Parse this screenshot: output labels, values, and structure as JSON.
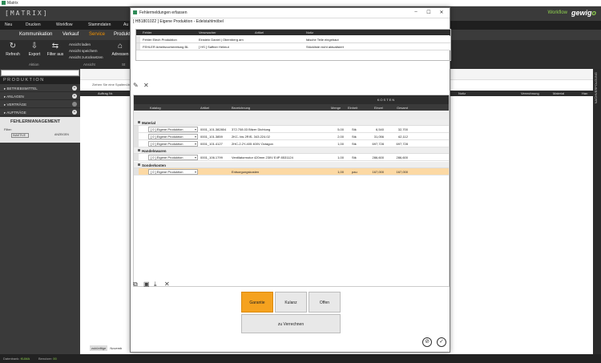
{
  "app": {
    "title": "Matrix",
    "brand": "[MATRIX]",
    "workflow_label": "Workflow",
    "brand_logo_text": "gewigo",
    "menu": [
      "Neu",
      "Drucken",
      "Workflow",
      "Stammdaten",
      "Au"
    ],
    "ribbon_tabs": [
      "Kommunikation",
      "Verkauf",
      "Service",
      "Produkt"
    ],
    "ribbon_active_tab": "Service",
    "ribbon_buttons": [
      {
        "label": "Refresh",
        "icon": "refresh-icon"
      },
      {
        "label": "Export",
        "icon": "export-icon"
      },
      {
        "label": "Filter aus",
        "icon": "filter-off-icon"
      },
      {
        "label": "Adressen",
        "icon": "address-icon"
      }
    ],
    "view_actions": [
      "Ansicht laden",
      "Ansicht speichern",
      "Ansicht zurücksetzen"
    ],
    "ribbon_groups": [
      "Aktion",
      "Ansicht",
      "St"
    ],
    "sidebar": {
      "title": "PRODUKTION",
      "items": [
        "BETRIEBSMITTEL",
        "ANLAGEN",
        "VERTRÄGE",
        "AUFTRÄGE"
      ],
      "active_section": "FEHLERMANAGEMENT",
      "filter_label": "Filter:",
      "inactive_checkbox": "INAKTIVE",
      "show_label": "ANZEIGEN"
    },
    "background_grid": {
      "hint": "Ziehen Sie eine Spaltenüb",
      "columns_left": [
        "Auftrag Nr."
      ],
      "columns_right": [
        "Notiz",
        "Verrechnung",
        "Material",
        "Han"
      ]
    },
    "bottom_tabs": [
      "zukünftige",
      "Novemb"
    ],
    "right_rail_label": "NACHVERFOLGUNG",
    "status": {
      "label1": "Datenbank:",
      "value1": "KUMA",
      "label2": "Benutzer:",
      "value2": "00"
    }
  },
  "dialog": {
    "title": "Fehlermeldungen erfassen",
    "subtitle": "[ HB1801022 ] Eigene Produktion - Edelstahlmöbel",
    "window_controls": {
      "minimize": "–",
      "maximize": "☐",
      "close": "✕"
    },
    "fehler_table": {
      "headers": [
        "Fehler",
        "Verursacher",
        "Verursacher",
        "Artikel",
        "Notiz"
      ],
      "rows": [
        {
          "fehler": "Fehler Elech Produktion",
          "verursacher": "Einstein Daniel | Obernberg am",
          "artikel": "",
          "notiz": "falsche Teile eingebaut"
        },
        {
          "fehler": "FEHLER Arbeitsvorbereitung BL",
          "verursacher": "[ HS ] Saffner Helmut",
          "artikel": "",
          "notiz": "Stückliste nicht aktualisiert"
        }
      ]
    },
    "kosten_table": {
      "group_header": "KOSTEN",
      "headers": [
        "Katalog",
        "Artikel",
        "Bezeichnung",
        "Menge",
        "Einheit",
        "Einzel",
        "Gesamt"
      ],
      "groups": [
        {
          "name": "Material",
          "rows": [
            {
              "katalog": "[ 0 ] Eigene Produktion",
              "artikel": "0001_101.382804",
              "bezeichnung": "372.708.03 Bitzer Dichtung",
              "menge": "5,00",
              "einheit": "Stk",
              "einzel": "6,540",
              "gesamt": "32,700"
            },
            {
              "katalog": "[ 0 ] Eigene Produktion",
              "artikel": "0001_101.3859",
              "bezeichnung": "2KC- bis 2RIS-   343.224.02",
              "menge": "2,00",
              "einheit": "Stk",
              "einzel": "31,056",
              "gesamt": "62,112"
            },
            {
              "katalog": "[ 0 ] Eigene Produktion",
              "artikel": "0001_101.4127",
              "bezeichnung": "2HC-2.2Y-405 400V Octagon",
              "menge": "1,00",
              "einheit": "Stk",
              "einzel": "697,728",
              "gesamt": "697,728"
            }
          ]
        },
        {
          "name": "Handelswaren",
          "rows": [
            {
              "katalog": "[ 0 ] Eigene Produktion",
              "artikel": "0001_106.1799",
              "bezeichnung": "Ventilatormotor 420mm 230V E4P 8531124",
              "menge": "1,00",
              "einheit": "Stk",
              "einzel": "286,600",
              "gesamt": "286,600"
            }
          ]
        },
        {
          "name": "Sonderkosten",
          "rows": [
            {
              "katalog": "[ 0 ] Eigene Produktion",
              "artikel": "",
              "bezeichnung": "Entsorgungskosten",
              "menge": "1,00",
              "einheit": "pau",
              "einzel": "167,000",
              "gesamt": "167,000",
              "highlight": true
            }
          ]
        }
      ]
    },
    "buttons": {
      "garantie": "Garantie",
      "kulanz": "Kulanz",
      "offen": "Offen",
      "verrechnen": "zu Verrechnen"
    },
    "selected_button": "Garantie"
  },
  "colors": {
    "accent_orange": "#f5a21f",
    "brand_green": "#8fd14f",
    "header_dark": "#2d2d2d",
    "highlight_row": "#fcd9a4"
  }
}
